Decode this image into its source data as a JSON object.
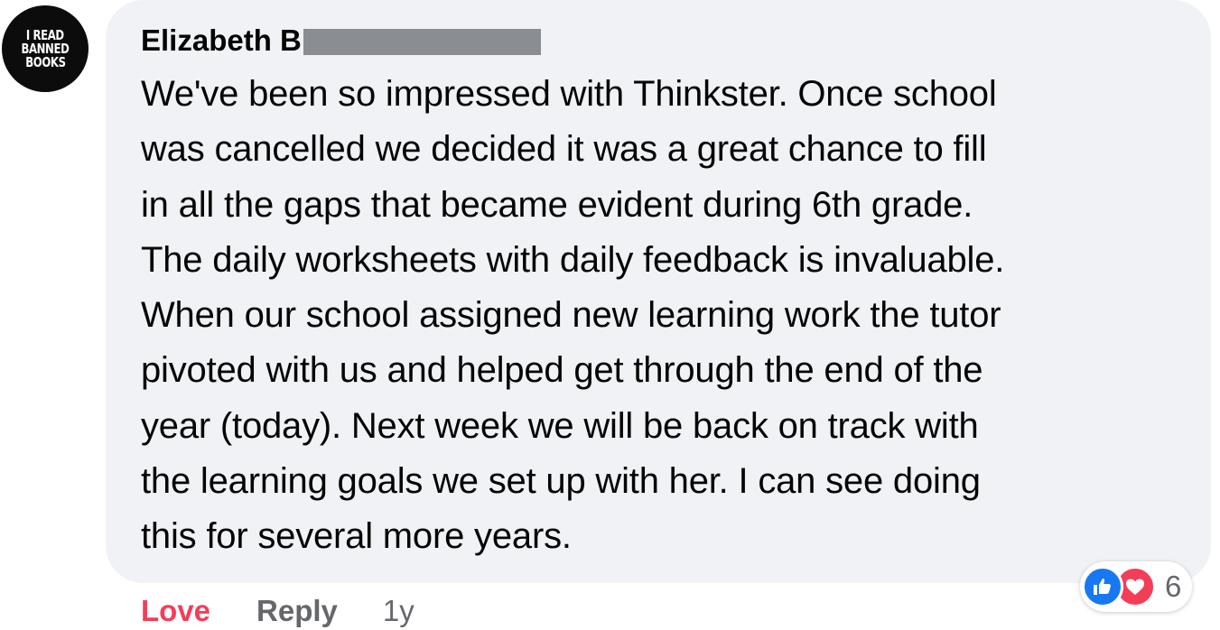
{
  "comment": {
    "avatar": {
      "icon": "avatar-badge-icon",
      "lines": [
        "I READ",
        "BANNED",
        "BOOKS"
      ],
      "background": "#0c0c0c"
    },
    "author": {
      "name": "Elizabeth B",
      "redacted": true
    },
    "text_lines": [
      "We've been so impressed with Thinkster. Once school",
      "was cancelled we decided it was a great chance to fill",
      "in all the gaps that became evident during 6th grade.",
      "The daily worksheets with daily feedback is invaluable.",
      "When our school assigned new learning work the tutor",
      "pivoted with us and helped get through the end of the",
      "year (today). Next week we will be back on track with",
      "the learning goals we set up with her. I can see doing",
      "this for several more years."
    ],
    "reactions": {
      "icons": [
        "like-icon",
        "love-icon"
      ],
      "count": "6"
    },
    "actions": {
      "love_label": "Love",
      "reply_label": "Reply",
      "timestamp": "1y"
    }
  },
  "colors": {
    "bubble_bg": "#f0f2f5",
    "text": "#050505",
    "secondary": "#65676b",
    "love": "#f33e58",
    "like": "#1877f2",
    "redaction": "#8a8d91"
  }
}
